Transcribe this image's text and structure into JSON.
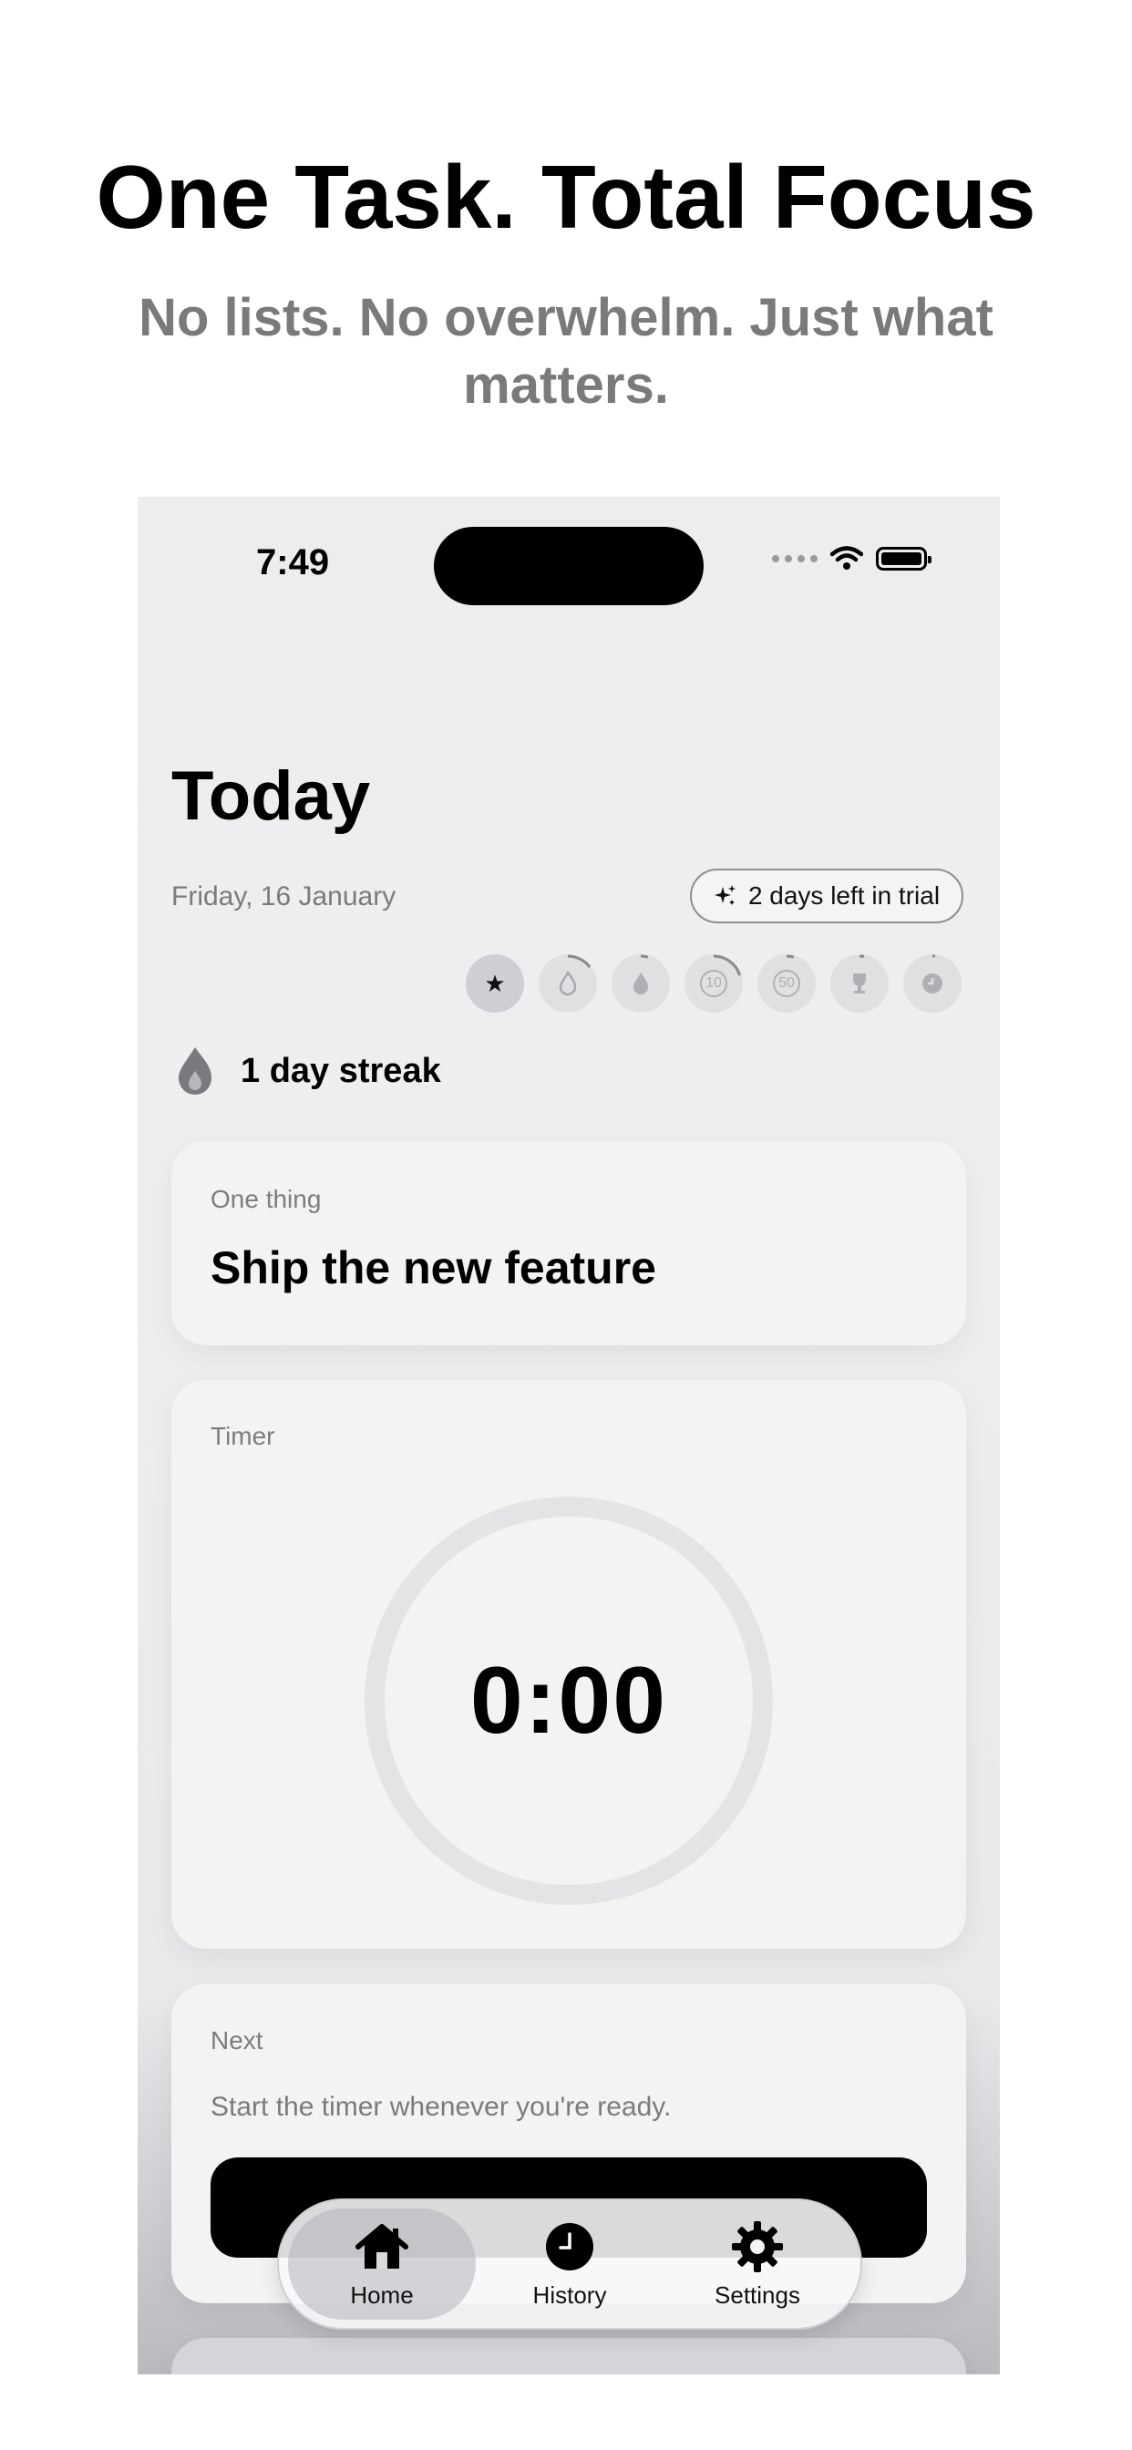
{
  "promo": {
    "headline": "One Task. Total Focus",
    "subline": "No lists. No overwhelm. Just what matters."
  },
  "status_bar": {
    "time": "7:49"
  },
  "header": {
    "title": "Today",
    "date": "Friday, 16 January",
    "trial_badge": "2 days left in trial"
  },
  "achievements": [
    {
      "icon": "star-icon",
      "glyph": "★",
      "active": true
    },
    {
      "icon": "flame-outline-icon",
      "glyph": "",
      "progress": 0.15
    },
    {
      "icon": "flame-icon",
      "glyph": "",
      "progress": 0.05
    },
    {
      "icon": "ten-badge-icon",
      "glyph": "10",
      "progress": 0.2
    },
    {
      "icon": "fifty-badge-icon",
      "glyph": "50",
      "progress": 0.05
    },
    {
      "icon": "trophy-icon",
      "glyph": "",
      "progress": 0.03
    },
    {
      "icon": "clock-badge-icon",
      "glyph": "",
      "progress": 0.02
    }
  ],
  "streak": {
    "text": "1 day streak",
    "icon": "flame-icon"
  },
  "task_card": {
    "label": "One thing",
    "value": "Ship the new feature"
  },
  "timer_card": {
    "label": "Timer",
    "value": "0:00"
  },
  "next_card": {
    "label": "Next",
    "message": "Start the timer whenever you're ready."
  },
  "tab_bar": {
    "tabs": [
      {
        "label": "Home",
        "icon": "house-icon",
        "selected": true
      },
      {
        "label": "History",
        "icon": "clock-icon",
        "selected": false
      },
      {
        "label": "Settings",
        "icon": "gear-icon",
        "selected": false
      }
    ]
  },
  "colors": {
    "accent": "#000000",
    "muted_text": "#7b7b7b",
    "card_bg": "#f3f3f4"
  }
}
